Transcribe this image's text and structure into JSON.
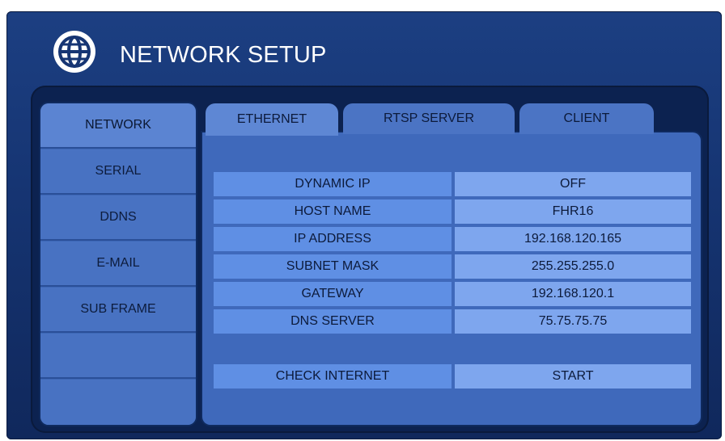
{
  "header": {
    "title": "NETWORK SETUP",
    "icon": "globe-icon"
  },
  "sidebar": {
    "items": [
      {
        "label": "NETWORK",
        "active": true
      },
      {
        "label": "SERIAL",
        "active": false
      },
      {
        "label": "DDNS",
        "active": false
      },
      {
        "label": "E-MAIL",
        "active": false
      },
      {
        "label": "SUB FRAME",
        "active": false
      },
      {
        "label": "",
        "active": false
      },
      {
        "label": "",
        "active": false
      }
    ]
  },
  "tabs": [
    {
      "label": "ETHERNET",
      "active": true
    },
    {
      "label": "RTSP SERVER",
      "active": false
    },
    {
      "label": "CLIENT",
      "active": false
    }
  ],
  "settings": [
    {
      "label": "DYNAMIC IP",
      "value": "OFF"
    },
    {
      "label": "HOST NAME",
      "value": "FHR16"
    },
    {
      "label": "IP ADDRESS",
      "value": "192.168.120.165"
    },
    {
      "label": "SUBNET MASK",
      "value": "255.255.255.0"
    },
    {
      "label": "GATEWAY",
      "value": "192.168.120.1"
    },
    {
      "label": "DNS SERVER",
      "value": "75.75.75.75"
    }
  ],
  "check_internet": {
    "label": "CHECK INTERNET",
    "action": "START"
  },
  "colors": {
    "frame": "#1c3f82",
    "panel": "#3f69bb",
    "label_cell": "#5f8fe4",
    "value_cell": "#7ea6ee"
  }
}
